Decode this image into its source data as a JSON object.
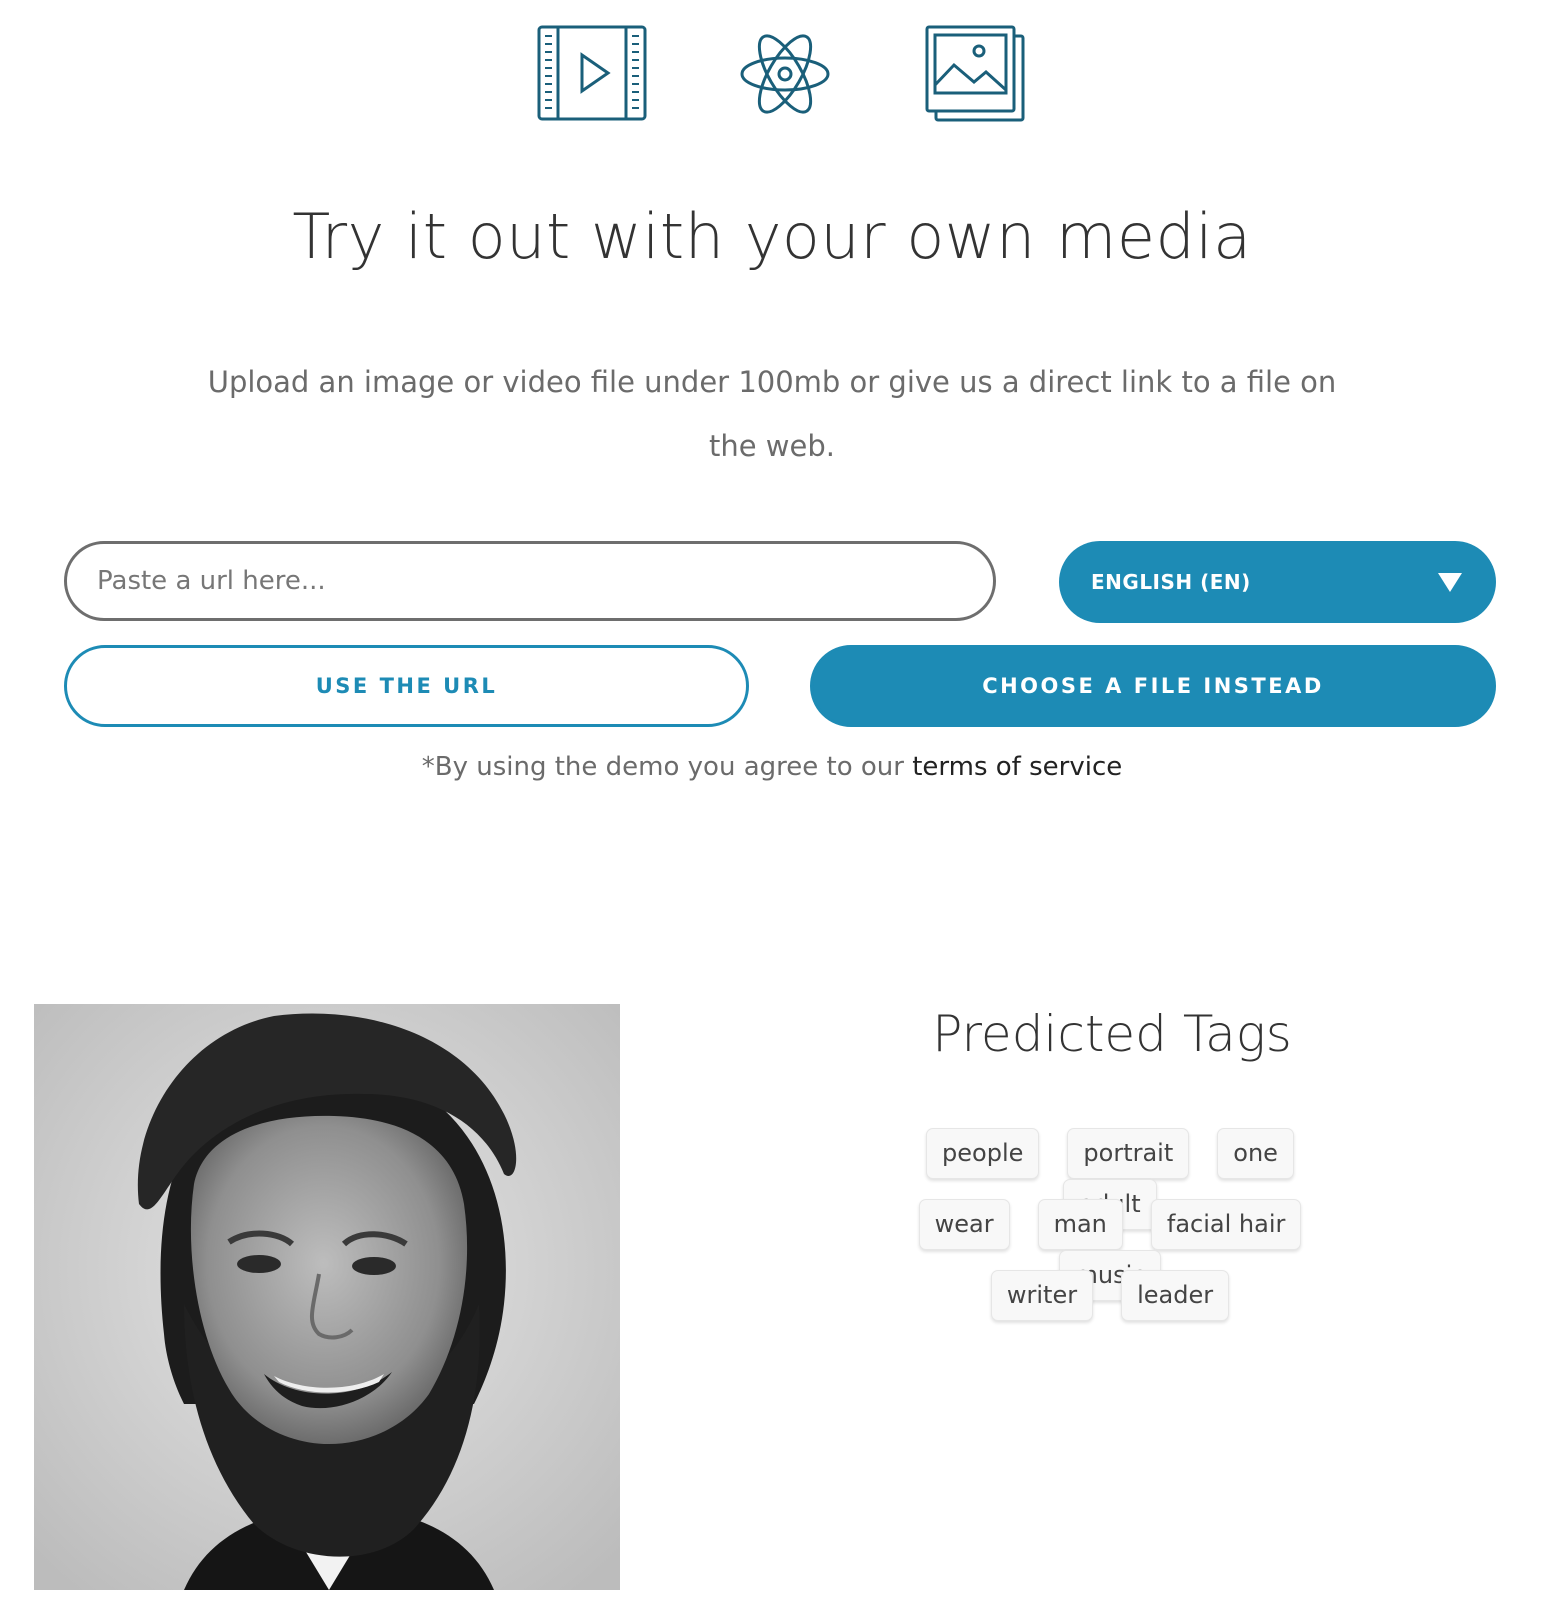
{
  "icons": {
    "video": "video-icon",
    "atom": "atom-icon",
    "image": "image-gallery-icon"
  },
  "colors": {
    "accent": "#1d8bb5",
    "icon_stroke": "#1a5f7a"
  },
  "headline": "Try it out with your own media",
  "subtext": "Upload an image or video file under 100mb or give us a direct link to a file on the web.",
  "url_input": {
    "placeholder": "Paste a url here...",
    "value": ""
  },
  "language_select": {
    "selected": "ENGLISH (EN)"
  },
  "buttons": {
    "use_url": "USE THE URL",
    "choose_file": "CHOOSE A FILE INSTEAD"
  },
  "terms": {
    "prefix": "*By using the demo you agree to our ",
    "link": "terms of service"
  },
  "photo": {
    "description": "black-and-white portrait of a bearded man"
  },
  "predicted_tags": {
    "title": "Predicted Tags",
    "rows": [
      [
        "people",
        "portrait",
        "one",
        "adult"
      ],
      [
        "wear",
        "man",
        "facial hair",
        "music"
      ],
      [
        "writer",
        "leader"
      ]
    ]
  }
}
